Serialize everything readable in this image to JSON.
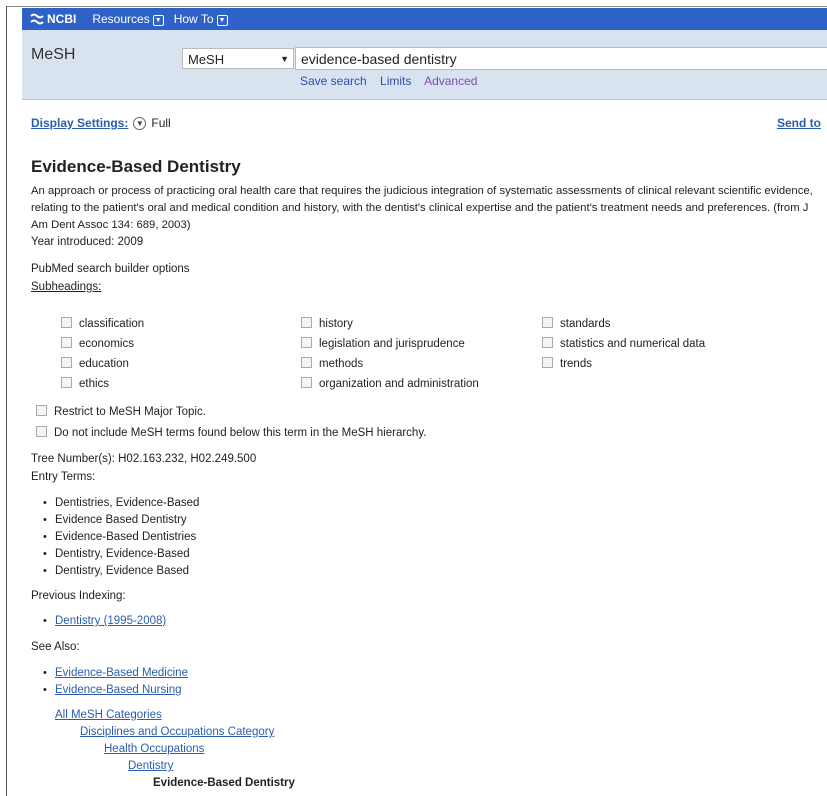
{
  "topbar": {
    "logo": "NCBI",
    "resources": "Resources",
    "howto": "How To"
  },
  "search": {
    "db_name": "MeSH",
    "db_select": "MeSH",
    "query": "evidence-based dentistry",
    "links": {
      "save": "Save search",
      "limits": "Limits",
      "advanced": "Advanced"
    }
  },
  "display": {
    "settings_label": "Display Settings:",
    "value": "Full",
    "send_to": "Send to"
  },
  "record": {
    "title": "Evidence-Based Dentistry",
    "description": "An approach or process of practicing oral health care that requires the judicious integration of systematic assessments of clinical relevant scientific evidence, relating to the patient's oral and medical condition and history, with the dentist's clinical expertise and the patient's treatment needs and preferences. (from J Am Dent Assoc 134: 689, 2003)",
    "year": "Year introduced: 2009",
    "builder_label": "PubMed search builder options",
    "subheadings_label": "Subheadings:",
    "subheadings_col1": [
      "classification",
      "economics",
      "education",
      "ethics"
    ],
    "subheadings_col2": [
      "history",
      "legislation and jurisprudence",
      "methods",
      "organization and administration"
    ],
    "subheadings_col3": [
      "standards",
      "statistics and numerical data",
      "trends"
    ],
    "restrict_major": "Restrict to MeSH Major Topic.",
    "no_below": "Do not include MeSH terms found below this term in the MeSH hierarchy.",
    "tree_numbers": "Tree Number(s): H02.163.232, H02.249.500",
    "entry_label": "Entry Terms:",
    "entry_terms": [
      "Dentistries, Evidence-Based",
      "Evidence Based Dentistry",
      "Evidence-Based Dentistries",
      "Dentistry, Evidence-Based",
      "Dentistry, Evidence Based"
    ],
    "prev_label": "Previous Indexing:",
    "prev_indexing": [
      "Dentistry (1995-2008)"
    ],
    "see_also_label": "See Also:",
    "see_also": [
      "Evidence-Based Medicine",
      "Evidence-Based Nursing"
    ],
    "tree": [
      "All MeSH Categories",
      "Disciplines and Occupations Category",
      "Health Occupations",
      "Dentistry",
      "Evidence-Based Dentistry"
    ]
  }
}
